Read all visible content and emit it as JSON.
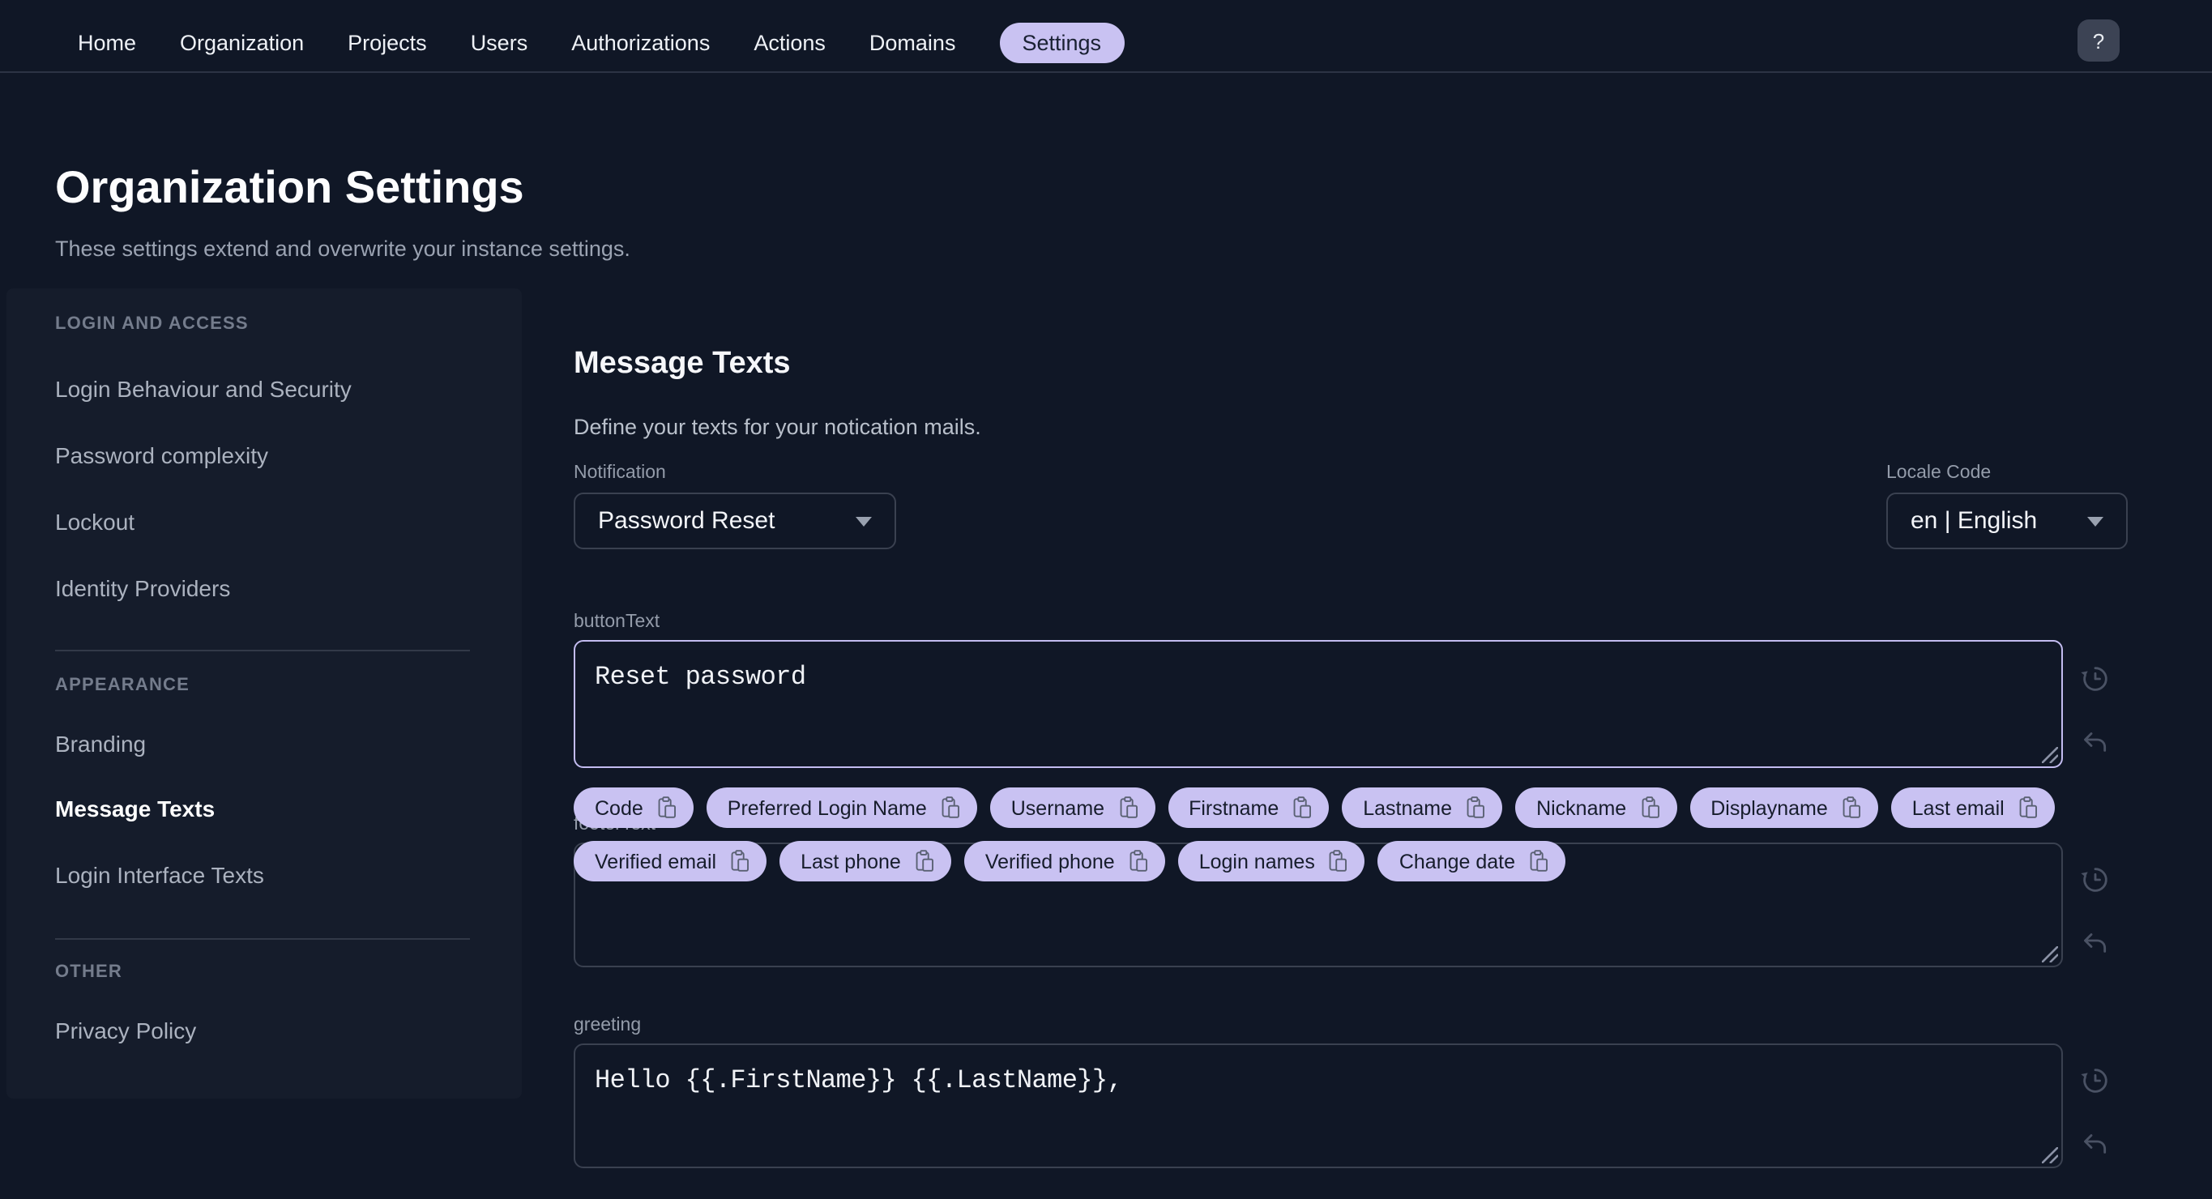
{
  "nav": {
    "items": [
      "Home",
      "Organization",
      "Projects",
      "Users",
      "Authorizations",
      "Actions",
      "Domains",
      "Settings"
    ],
    "active_item": "Settings",
    "help_label": "?"
  },
  "header": {
    "title": "Organization Settings",
    "subtitle": "These settings extend and overwrite your instance settings."
  },
  "sidebar": {
    "sections": [
      {
        "title": "LOGIN AND ACCESS",
        "items": [
          "Login Behaviour and Security",
          "Password complexity",
          "Lockout",
          "Identity Providers"
        ]
      },
      {
        "title": "APPEARANCE",
        "items": [
          "Branding",
          "Message Texts",
          "Login Interface Texts"
        ]
      },
      {
        "title": "OTHER",
        "items": [
          "Privacy Policy"
        ]
      }
    ],
    "active_item": "Message Texts"
  },
  "main": {
    "title": "Message Texts",
    "subtitle": "Define your texts for your notication mails.",
    "notification": {
      "label": "Notification",
      "value": "Password Reset"
    },
    "locale": {
      "label": "Locale Code",
      "value": "en | English"
    },
    "fields": {
      "buttonText": {
        "label": "buttonText",
        "value": "Reset password"
      },
      "footerText": {
        "label": "footerText",
        "value": ""
      },
      "greeting": {
        "label": "greeting",
        "value": "Hello {{.FirstName}} {{.LastName}},"
      }
    },
    "chips": [
      "Code",
      "Preferred Login Name",
      "Username",
      "Firstname",
      "Lastname",
      "Nickname",
      "Displayname",
      "Last email",
      "Verified email",
      "Last phone",
      "Verified phone",
      "Login names",
      "Change date"
    ]
  },
  "icons": {
    "help": "question-mark",
    "chip": "clipboard-copy",
    "field_history": "history-clock",
    "field_undo": "undo-arrow",
    "select_caret": "chevron-down"
  },
  "colors": {
    "background": "#101726",
    "panel": "#151c2b",
    "accent_lavender": "#c9c2f2",
    "focus_border": "#c3bcf0",
    "input_border": "#3a4150",
    "muted_text": "#9ba3b2"
  }
}
